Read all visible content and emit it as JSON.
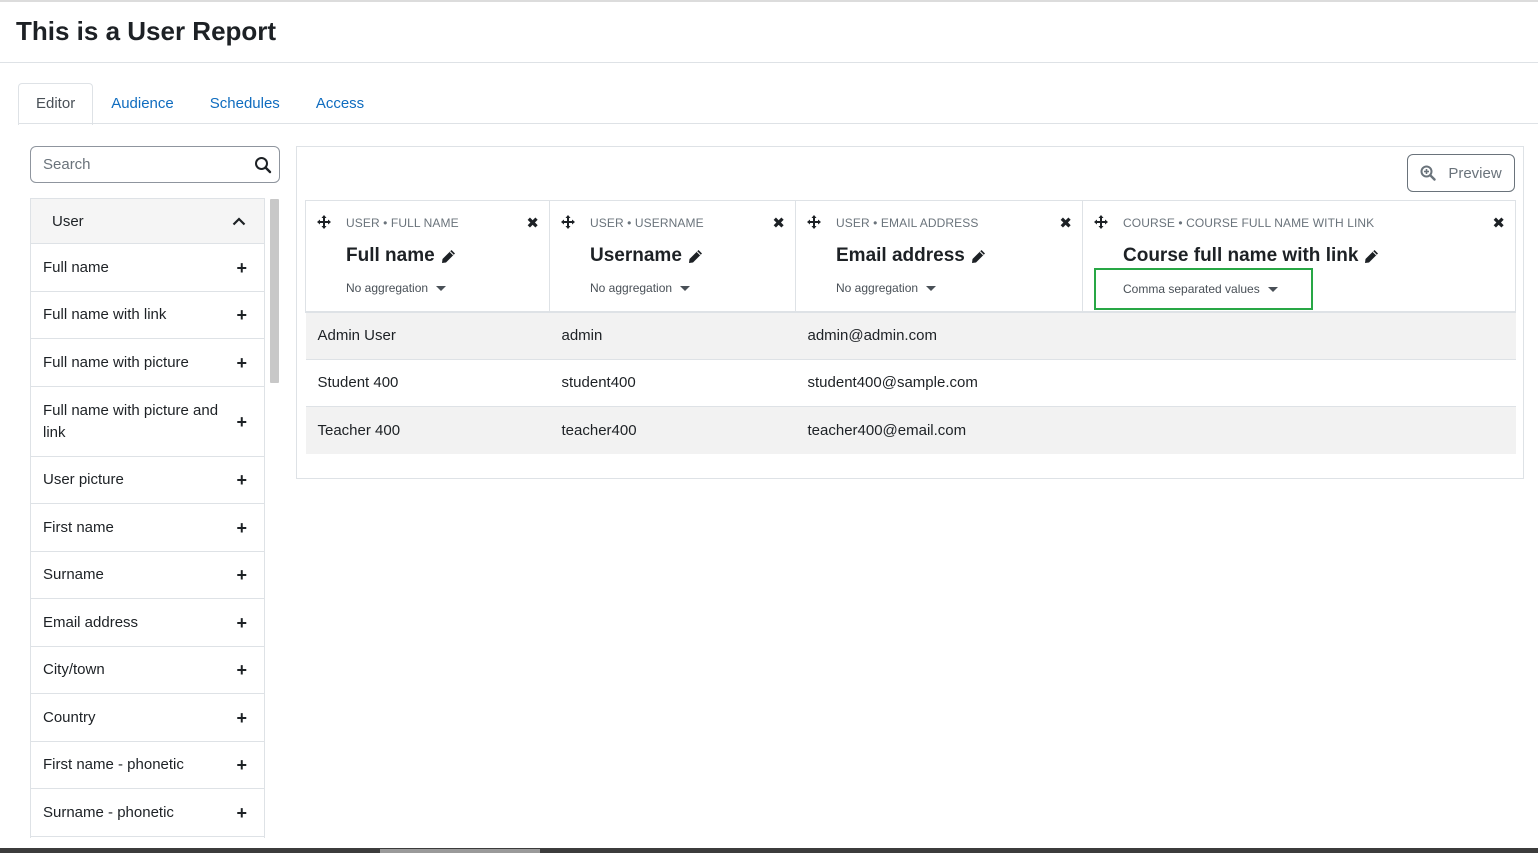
{
  "page": {
    "title": "This is a User Report"
  },
  "tabs": [
    "Editor",
    "Audience",
    "Schedules",
    "Access"
  ],
  "search": {
    "placeholder": "Search",
    "value": ""
  },
  "sidebar": {
    "section_title": "User",
    "items": [
      "Full name",
      "Full name with link",
      "Full name with picture",
      "Full name with picture and link",
      "User picture",
      "First name",
      "Surname",
      "Email address",
      "City/town",
      "Country",
      "First name - phonetic",
      "Surname - phonetic"
    ]
  },
  "toolbar": {
    "preview_label": "Preview"
  },
  "columns": [
    {
      "caption": "User • Full name",
      "title": "Full name",
      "aggregation": "No aggregation"
    },
    {
      "caption": "User • Username",
      "title": "Username",
      "aggregation": "No aggregation"
    },
    {
      "caption": "User • Email address",
      "title": "Email address",
      "aggregation": "No aggregation"
    },
    {
      "caption": "Course • Course full name with link",
      "title": "Course full name with link",
      "aggregation": "Comma separated values"
    }
  ],
  "rows": [
    [
      "Admin User",
      "admin",
      "admin@admin.com",
      ""
    ],
    [
      "Student 400",
      "student400",
      "student400@sample.com",
      ""
    ],
    [
      "Teacher 400",
      "teacher400",
      "teacher400@email.com",
      ""
    ]
  ],
  "colors": {
    "link": "#0f6cbf",
    "highlight": "#28a745",
    "striped_row": "#f2f2f2"
  },
  "icons": {
    "search": "search-icon",
    "preview": "zoom-in-icon",
    "move": "move-icon",
    "remove": "close-icon",
    "edit": "pencil-icon",
    "add": "plus-icon",
    "collapse": "chevron-up-icon"
  }
}
